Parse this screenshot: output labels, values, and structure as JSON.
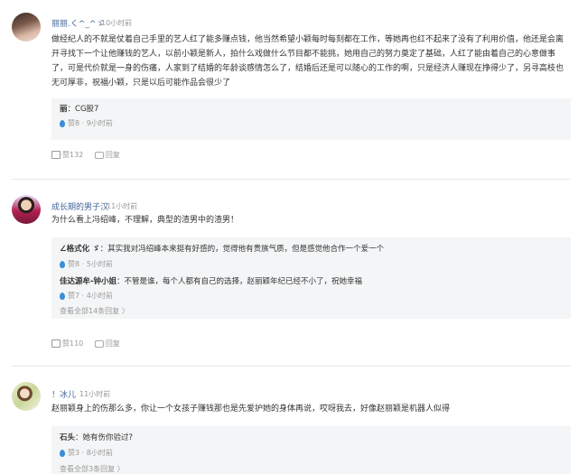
{
  "comments": [
    {
      "user": "丽丽.く^_^ゞ",
      "time": "10小时前",
      "text": "做经纪人的不就是仗着自己手里的艺人红了能多赚点钱，他当然希望小颖每时每刻都在工作，等她再也红不起来了没有了利用价值，他还是会离开寻找下一个让他赚钱的艺人，以前小颖是新人，拍什么戏做什么节目都不能挑，她用自己的努力奠定了基础，人红了能由着自己的心意做事了，可是代价就是一身的伤痛，人家到了结婚的年龄谈感情怎么了，结婚后还是可以随心的工作的啊，只是经济人赚现在挣得少了，另寻高枝也无可厚非，祝福小颖，只是以后可能作品会很少了",
      "replies": [
        {
          "name": "丽",
          "text": "：CG股7",
          "likes": "赞8",
          "time": "9小时前"
        }
      ],
      "likes": "赞132",
      "reply_label": "回复"
    },
    {
      "user": "成长期的男子汉",
      "time": "11小时前",
      "text": "为什么看上冯绍峰，不理解，典型的渣男中的渣男！",
      "replies": [
        {
          "name": "∠格式化 ゞ",
          "text": "：其实我对冯绍峰本来挺有好感的，觉得他有贵族气质，但是感觉他合作一个爱一个",
          "likes": "赞8",
          "time": "5小时前"
        },
        {
          "name": "佳达源牟-钟小姐",
          "text": "：不管是谁，每个人都有自己的选择，赵丽颖年纪已经不小了，祝她幸福",
          "likes": "赞7",
          "time": "4小时前"
        }
      ],
      "more": "查看全部14条回复 〉",
      "likes": "赞110",
      "reply_label": "回复"
    },
    {
      "user": "！冰儿",
      "time": "11小时前",
      "text": "赵丽颖身上的伤那么多，你让一个女孩子赚钱那也是先爱护她的身体再说，哎呀我去，好像赵丽颖是机器人似得",
      "replies": [
        {
          "name": "石头",
          "text": "：她有伤你验过?",
          "likes": "赞3",
          "time": "8小时前"
        }
      ],
      "more": "查看全部3条回复 〉"
    }
  ]
}
